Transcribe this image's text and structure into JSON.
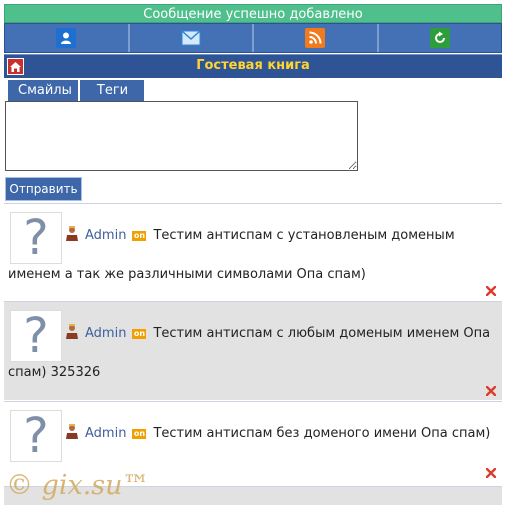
{
  "notice": "Сообщение успешно добавлено",
  "nav": {
    "icons": [
      "user-icon",
      "mail-icon",
      "rss-icon",
      "refresh-icon"
    ],
    "colors": [
      "#1e6fd0",
      "#2a88d8",
      "#f07a1c",
      "#2e9e3a"
    ]
  },
  "title": "Гостевая книга",
  "tabs": [
    "Смайлы",
    "Теги"
  ],
  "message": {
    "value": "",
    "placeholder": ""
  },
  "send_label": "Отправить",
  "posts": [
    {
      "avatar": "?",
      "user": "Admin",
      "status": "on",
      "text": "Тестим антиспам с установленым доменым именем а так же различными символами Опа спам)"
    },
    {
      "avatar": "?",
      "user": "Admin",
      "status": "on",
      "text": "Тестим антиспам с любым доменым именем Опа спам) 325326"
    },
    {
      "avatar": "?",
      "user": "Admin",
      "status": "on",
      "text": "Тестим антиспам без доменого имени Опа спам)"
    }
  ],
  "watermark": "© gix.su™"
}
